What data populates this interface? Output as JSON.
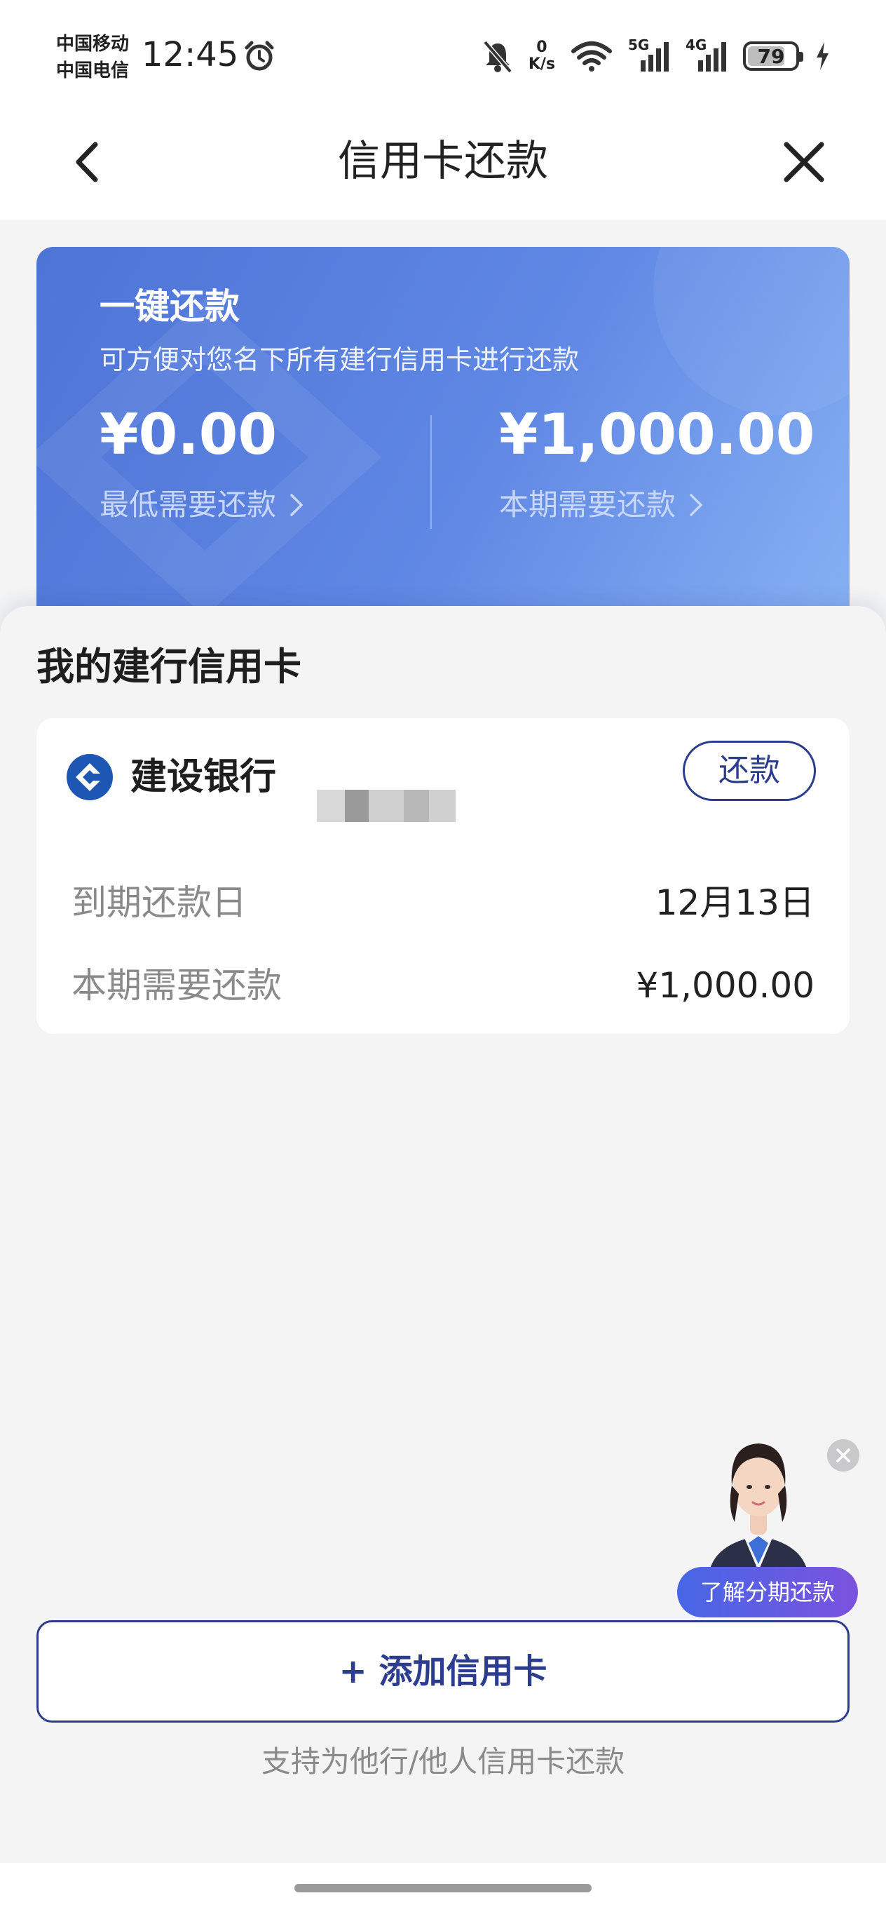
{
  "status_bar": {
    "carrier_1": "中国移动",
    "carrier_2": "中国电信",
    "time": "12:45",
    "net_speed_value": "0",
    "net_speed_unit": "K/s",
    "signal_1_label": "5G",
    "signal_2_label": "4G",
    "battery_level": "79",
    "icons": [
      "alarm-icon",
      "mute-bell-icon",
      "wifi-icon",
      "signal-icon",
      "battery-icon",
      "charging-icon"
    ]
  },
  "nav": {
    "title": "信用卡还款",
    "back_icon": "chevron-left-icon",
    "close_icon": "close-icon"
  },
  "hero": {
    "title": "一键还款",
    "subtitle": "可方便对您名下所有建行信用卡进行还款",
    "min_amount": "¥0.00",
    "min_label": "最低需要还款",
    "current_amount": "¥1,000.00",
    "current_label": "本期需要还款",
    "colors": {
      "start": "#4e74d6",
      "end": "#86b0f3"
    }
  },
  "cards_section": {
    "title": "我的建行信用卡",
    "cards": [
      {
        "bank_name": "建设银行",
        "repay_label": "还款",
        "due_label": "到期还款日",
        "due_value": "12月13日",
        "amount_label": "本期需要还款",
        "amount_value": "¥1,000.00"
      }
    ]
  },
  "assistant": {
    "bubble_label": "了解分期还款"
  },
  "add_card": {
    "label": "+ 添加信用卡",
    "note": "支持为他行/他人信用卡还款"
  },
  "theme": {
    "accent": "#2c3d8f",
    "background": "#f4f4f5"
  }
}
